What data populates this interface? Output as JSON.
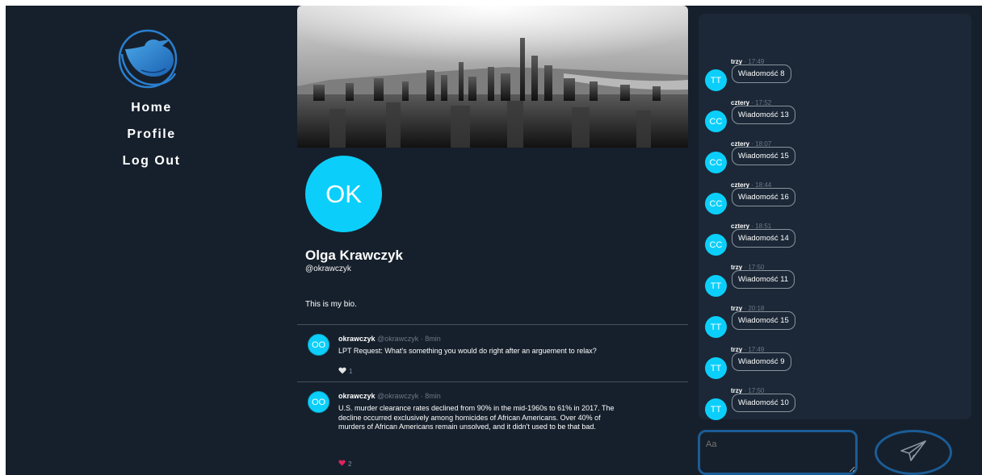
{
  "nav": {
    "home": "Home",
    "profile": "Profile",
    "logout": "Log Out"
  },
  "profile": {
    "initials": "OK",
    "name": "Olga Krawczyk",
    "handle": "@okrawczyk",
    "bio": "This is my bio."
  },
  "posts": [
    {
      "initials": "OO",
      "author": "okrawczyk",
      "handle": "@okrawczyk",
      "time": "8min",
      "text": "LPT Request: What's something you would do right after an arguement to relax?",
      "likes": "1"
    },
    {
      "initials": "OO",
      "author": "okrawczyk",
      "handle": "@okrawczyk",
      "time": "8min",
      "text": "U.S. murder clearance rates declined from 90% in the mid-1960s to 61% in 2017. The decline occurred exclusively among homicides of African Americans. Over 40% of murders of African Americans remain unsolved, and it didn't used to be that bad.",
      "likes": "2"
    }
  ],
  "messages": [
    {
      "initials": "TT",
      "user": "trzy",
      "time": "17:49",
      "text": "Wiadomość 8"
    },
    {
      "initials": "CC",
      "user": "cztery",
      "time": "17:52",
      "text": "Wiadomość 13"
    },
    {
      "initials": "CC",
      "user": "cztery",
      "time": "18:07",
      "text": "Wiadomość 15"
    },
    {
      "initials": "CC",
      "user": "cztery",
      "time": "18:44",
      "text": "Wiadomość 16"
    },
    {
      "initials": "CC",
      "user": "cztery",
      "time": "18:51",
      "text": "Wiadomość 14"
    },
    {
      "initials": "TT",
      "user": "trzy",
      "time": "17:50",
      "text": "Wiadomość 11"
    },
    {
      "initials": "TT",
      "user": "trzy",
      "time": "20:18",
      "text": "Wiadomość 15"
    },
    {
      "initials": "TT",
      "user": "trzy",
      "time": "17:49",
      "text": "Wiadomość 9"
    },
    {
      "initials": "TT",
      "user": "trzy",
      "time": "17:50",
      "text": "Wiadomość 10"
    }
  ],
  "chat_input": {
    "placeholder": "Aa"
  },
  "colors": {
    "panel": "#16202c",
    "chat_box": "#1c2837",
    "avatar": "#0bcffa",
    "border_accent": "#1b5c96",
    "like_red": "#e0245e"
  },
  "icons": {
    "logo": "bird-logo-icon",
    "like_empty": "heart-icon",
    "like_filled": "heart-filled-icon",
    "send": "paper-plane-icon"
  }
}
